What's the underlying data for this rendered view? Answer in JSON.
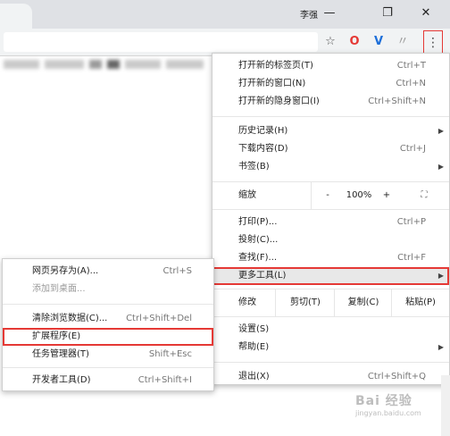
{
  "titlebar": {
    "user_label": "李强",
    "minimize": "—",
    "maximize": "❐",
    "close": "✕"
  },
  "toolbar": {
    "star_icon": "☆",
    "opera_icon": "O",
    "v_icon": "V",
    "feather_icon": "〃",
    "menu_icon": "⋮"
  },
  "main_menu": {
    "new_tab": {
      "label": "打开新的标签页(T)",
      "shortcut": "Ctrl+T"
    },
    "new_window": {
      "label": "打开新的窗口(N)",
      "shortcut": "Ctrl+N"
    },
    "new_incognito": {
      "label": "打开新的隐身窗口(I)",
      "shortcut": "Ctrl+Shift+N"
    },
    "history": {
      "label": "历史记录(H)"
    },
    "downloads": {
      "label": "下载内容(D)",
      "shortcut": "Ctrl+J"
    },
    "bookmarks": {
      "label": "书签(B)"
    },
    "zoom": {
      "label": "缩放",
      "minus": "-",
      "value": "100%",
      "plus": "+",
      "fullscreen": "⛶"
    },
    "print": {
      "label": "打印(P)...",
      "shortcut": "Ctrl+P"
    },
    "cast": {
      "label": "投射(C)..."
    },
    "find": {
      "label": "查找(F)...",
      "shortcut": "Ctrl+F"
    },
    "more_tools": {
      "label": "更多工具(L)"
    },
    "edit": {
      "label": "修改",
      "cut": "剪切(T)",
      "copy": "复制(C)",
      "paste": "粘贴(P)"
    },
    "settings": {
      "label": "设置(S)"
    },
    "help": {
      "label": "帮助(E)"
    },
    "exit": {
      "label": "退出(X)",
      "shortcut": "Ctrl+Shift+Q"
    }
  },
  "sub_menu": {
    "save_page": {
      "label": "网页另存为(A)...",
      "shortcut": "Ctrl+S"
    },
    "add_to_desktop": {
      "label": "添加到桌面..."
    },
    "clear_data": {
      "label": "清除浏览数据(C)...",
      "shortcut": "Ctrl+Shift+Del"
    },
    "extensions": {
      "label": "扩展程序(E)"
    },
    "task_manager": {
      "label": "任务管理器(T)",
      "shortcut": "Shift+Esc"
    },
    "dev_tools": {
      "label": "开发者工具(D)",
      "shortcut": "Ctrl+Shift+I"
    }
  },
  "watermark": {
    "line1": "Bai 经验",
    "line2": "jingyan.baidu.com"
  },
  "colors": {
    "highlight_box": "#e53935",
    "titlebar": "#dfe1e5",
    "toolbar": "#f1f3f4"
  }
}
